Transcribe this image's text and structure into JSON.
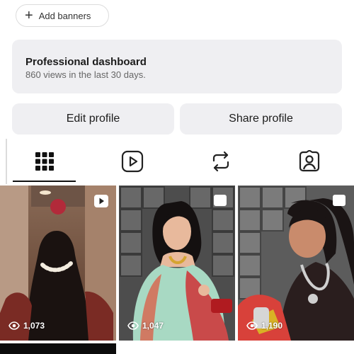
{
  "banner": {
    "label": "Add banners"
  },
  "dashboard": {
    "title": "Professional dashboard",
    "subtitle": "860 views in the last 30 days."
  },
  "actions": {
    "edit": "Edit profile",
    "share": "Share profile"
  },
  "tabs": [
    {
      "icon": "grid-icon",
      "active": true
    },
    {
      "icon": "reels-icon",
      "active": false
    },
    {
      "icon": "repost-icon",
      "active": false
    },
    {
      "icon": "tagged-icon",
      "active": false
    }
  ],
  "posts": [
    {
      "views": "1,073",
      "icon": "reel-icon"
    },
    {
      "views": "1,047",
      "icon": "multiple-icon"
    },
    {
      "views": "1,190",
      "icon": "multiple-icon"
    }
  ],
  "colors": {
    "card_bg": "#efeff2",
    "text": "#1c1c1c",
    "muted": "#666666"
  }
}
